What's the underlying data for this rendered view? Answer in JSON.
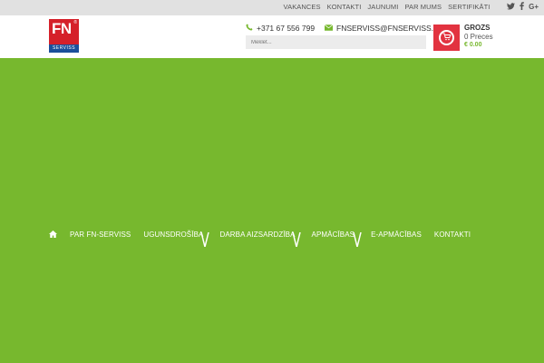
{
  "topbar": {
    "links": [
      "VAKANCES",
      "KONTAKTI",
      "JAUNUMI",
      "PAR MUMS",
      "SERTIFIKĀTI"
    ],
    "social": [
      "twitter-icon",
      "facebook-icon",
      "google-plus-icon"
    ]
  },
  "header": {
    "logo": {
      "main": "FN",
      "sub": "SERVISS"
    },
    "phone": "+371 67 556 799",
    "email": "FNSERVISS@FNSERVISS.LV",
    "search_placeholder": "Meklēt...",
    "cart": {
      "title": "GROZS",
      "count": "0 Preces",
      "price": "€ 0.00"
    }
  },
  "nav": {
    "items": [
      "PAR FN-SERVISS",
      "UGUNSDROŠĪBA",
      "DARBA AIZSARDZĪBA",
      "APMĀCĪBAS",
      "E-APMĀCĪBAS",
      "KONTAKTI"
    ]
  },
  "colors": {
    "accent": "#77b82e",
    "brand_red": "#d5202a",
    "brand_blue": "#1b4f9b",
    "cart_red": "#e23340"
  }
}
